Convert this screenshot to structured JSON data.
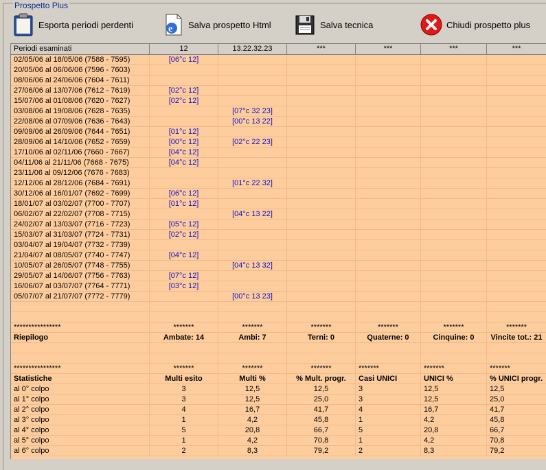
{
  "frame_title": "Prospetto Plus",
  "toolbar": {
    "export_label": "Esporta periodi perdenti",
    "save_html_label": "Salva prospetto Html",
    "save_tech_label": "Salva tecnica",
    "close_label": "Chiudi prospetto plus"
  },
  "columns": [
    "Periodi esaminati",
    "12",
    "13.22.32.23",
    "***",
    "***",
    "***",
    "***"
  ],
  "periods": [
    [
      "02/05/06 al 18/05/06  (7588 - 7595)",
      "[06°c 12]",
      ""
    ],
    [
      "20/05/06 al 06/06/06  (7596 - 7603)",
      "",
      ""
    ],
    [
      "08/06/06 al 24/06/06  (7604 - 7611)",
      "",
      ""
    ],
    [
      "27/06/06 al 13/07/06  (7612 - 7619)",
      "[02°c 12]",
      ""
    ],
    [
      "15/07/06 al 01/08/06  (7620 - 7627)",
      "[02°c 12]",
      ""
    ],
    [
      "03/08/06 al 19/08/06  (7628 - 7635)",
      "",
      "[07°c 32 23]"
    ],
    [
      "22/08/06 al 07/09/06  (7636 - 7643)",
      "",
      "[00°c 13 22]"
    ],
    [
      "09/09/06 al 26/09/06  (7644 - 7651)",
      "[01°c 12]",
      ""
    ],
    [
      "28/09/06 al 14/10/06  (7652 - 7659)",
      "[00°c 12]",
      "[02°c 22 23]"
    ],
    [
      "17/10/06 al 02/11/06  (7660 - 7667)",
      "[04°c 12]",
      ""
    ],
    [
      "04/11/06 al 21/11/06  (7668 - 7675)",
      "[04°c 12]",
      ""
    ],
    [
      "23/11/06 al 09/12/06  (7676 - 7683)",
      "",
      ""
    ],
    [
      "12/12/06 al 28/12/06  (7684 - 7691)",
      "",
      "[01°c 22 32]"
    ],
    [
      "30/12/06 al 16/01/07  (7692 - 7699)",
      "[06°c 12]",
      ""
    ],
    [
      "18/01/07 al 03/02/07  (7700 - 7707)",
      "[01°c 12]",
      ""
    ],
    [
      "06/02/07 al 22/02/07  (7708 - 7715)",
      "",
      "[04°c 13 22]"
    ],
    [
      "24/02/07 al 13/03/07  (7716 - 7723)",
      "[05°c 12]",
      ""
    ],
    [
      "15/03/07 al 31/03/07  (7724 - 7731)",
      "[02°c 12]",
      ""
    ],
    [
      "03/04/07 al 19/04/07  (7732 - 7739)",
      "",
      ""
    ],
    [
      "21/04/07 al 08/05/07  (7740 - 7747)",
      "[04°c 12]",
      ""
    ],
    [
      "10/05/07 al 26/05/07  (7748 - 7755)",
      "",
      "[04°c 13 32]"
    ],
    [
      "29/05/07 al 14/06/07  (7756 - 7763)",
      "[07°c 12]",
      ""
    ],
    [
      "16/06/07 al 03/07/07  (7764 - 7771)",
      "[03°c 12]",
      ""
    ],
    [
      "05/07/07 al 21/07/07  (7772 - 7779)",
      "",
      "[00°c 13 23]"
    ]
  ],
  "stars_long": "****************",
  "stars_short": "*******",
  "riepilogo": [
    "Riepilogo",
    "Ambate: 14",
    "Ambi: 7",
    "Terni: 0",
    "Quaterne: 0",
    "Cinquine: 0",
    "Vincite tot.: 21"
  ],
  "stat_headers": [
    "Statistiche",
    "Multi esito",
    "Multi %",
    "% Mult. progr.",
    "Casi UNICI",
    "UNICI %",
    "% UNICI progr."
  ],
  "stats": [
    [
      "al 0° colpo",
      "3",
      "12,5",
      "12,5",
      "3",
      "12,5",
      "12,5"
    ],
    [
      "al 1° colpo",
      "3",
      "12,5",
      "25,0",
      "3",
      "12,5",
      "25,0"
    ],
    [
      "al 2° colpo",
      "4",
      "16,7",
      "41,7",
      "4",
      "16,7",
      "41,7"
    ],
    [
      "al 3° colpo",
      "1",
      "4,2",
      "45,8",
      "1",
      "4,2",
      "45,8"
    ],
    [
      "al 4° colpo",
      "5",
      "20,8",
      "66,7",
      "5",
      "20,8",
      "66,7"
    ],
    [
      "al 5° colpo",
      "1",
      "4,2",
      "70,8",
      "1",
      "4,2",
      "70,8"
    ],
    [
      "al 6° colpo",
      "2",
      "8,3",
      "79,2",
      "2",
      "8,3",
      "79,2"
    ]
  ],
  "colors": {
    "grid_bg": "#fdcd9e",
    "link_blue": "#1010c8",
    "window_bg": "#d4d0c8"
  }
}
